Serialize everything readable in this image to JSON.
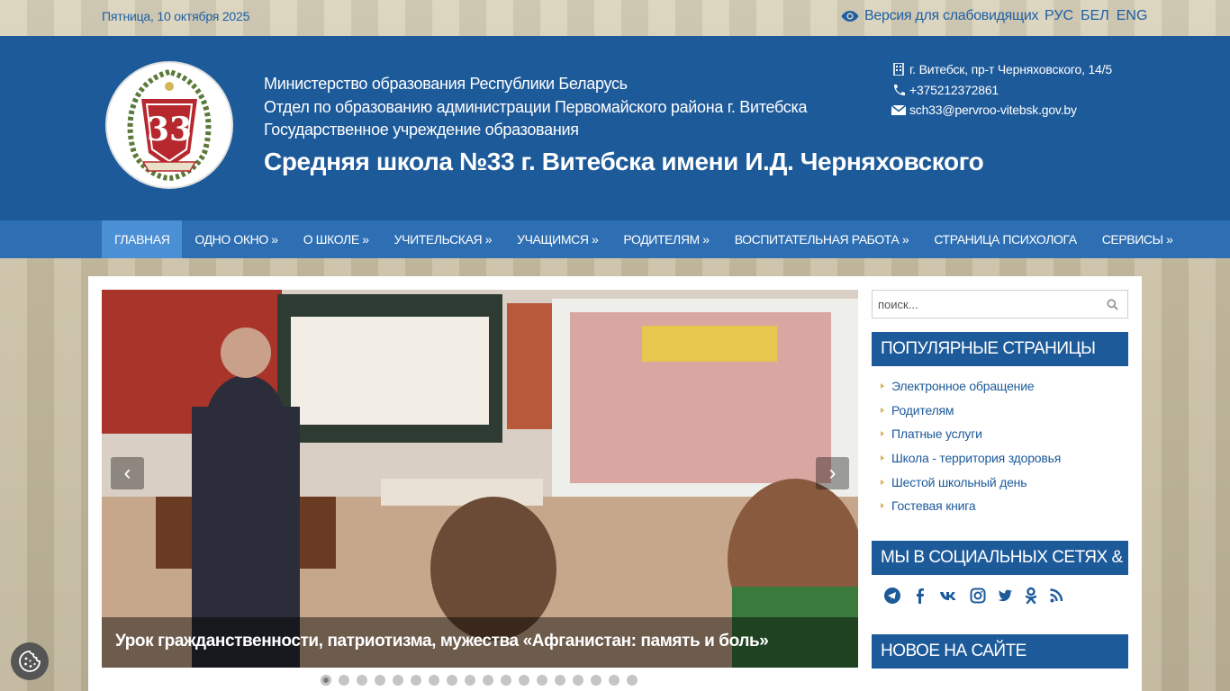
{
  "topbar": {
    "date": "Пятница, 10 октября 2025",
    "impaired_label": "Версия для слабовидящих",
    "languages": [
      "РУС",
      "БЕЛ",
      "ENG"
    ]
  },
  "header": {
    "org_lines": [
      "Министерство образования Республики Беларусь",
      "Отдел по образованию администрации Первомайского района г. Витебска",
      "Государственное учреждение образования"
    ],
    "school_title": "Средняя школа №33 г. Витебска имени И.Д. Черняховского",
    "contacts": {
      "address": "г. Витебск, пр-т Черняховского, 14/5",
      "phone": "+375212372861",
      "email": "sch33@pervroo-vitebsk.gov.by"
    }
  },
  "nav": {
    "items": [
      "ГЛАВНАЯ",
      "ОДНО ОКНО »",
      "О ШКОЛЕ »",
      "УЧИТЕЛЬСКАЯ »",
      "УЧАЩИМСЯ »",
      "РОДИТЕЛЯМ »",
      "ВОСПИТАТЕЛЬНАЯ РАБОТА »",
      "СТРАНИЦА ПСИХОЛОГА",
      "СЕРВИСЫ »"
    ],
    "active_index": 0
  },
  "slider": {
    "caption": "Урок гражданственности, патриотизма, мужества «Афганистан: память и боль»",
    "prev_label": "‹",
    "next_label": "›",
    "dot_count": 18,
    "active_dot": 0
  },
  "sidebar": {
    "search_placeholder": "поиск...",
    "popular_title": "ПОПУЛЯРНЫЕ СТРАНИЦЫ",
    "popular_items": [
      "Электронное обращение",
      "Родителям",
      "Платные услуги",
      "Школа - территория здоровья",
      "Шестой школьный день",
      "Гостевая книга"
    ],
    "social_title": "МЫ В СОЦИАЛЬНЫХ СЕТЯХ & RSS",
    "social_icons": [
      "telegram-icon",
      "facebook-icon",
      "vk-icon",
      "instagram-icon",
      "twitter-icon",
      "odnoklassniki-icon",
      "rss-icon"
    ],
    "news_title": "НОВОЕ НА САЙТЕ"
  },
  "colors": {
    "brand_blue": "#1d5a9a",
    "nav_blue": "#2e6fb4",
    "nav_active": "#4b8fd4",
    "link_blue": "#1d5fa5"
  }
}
